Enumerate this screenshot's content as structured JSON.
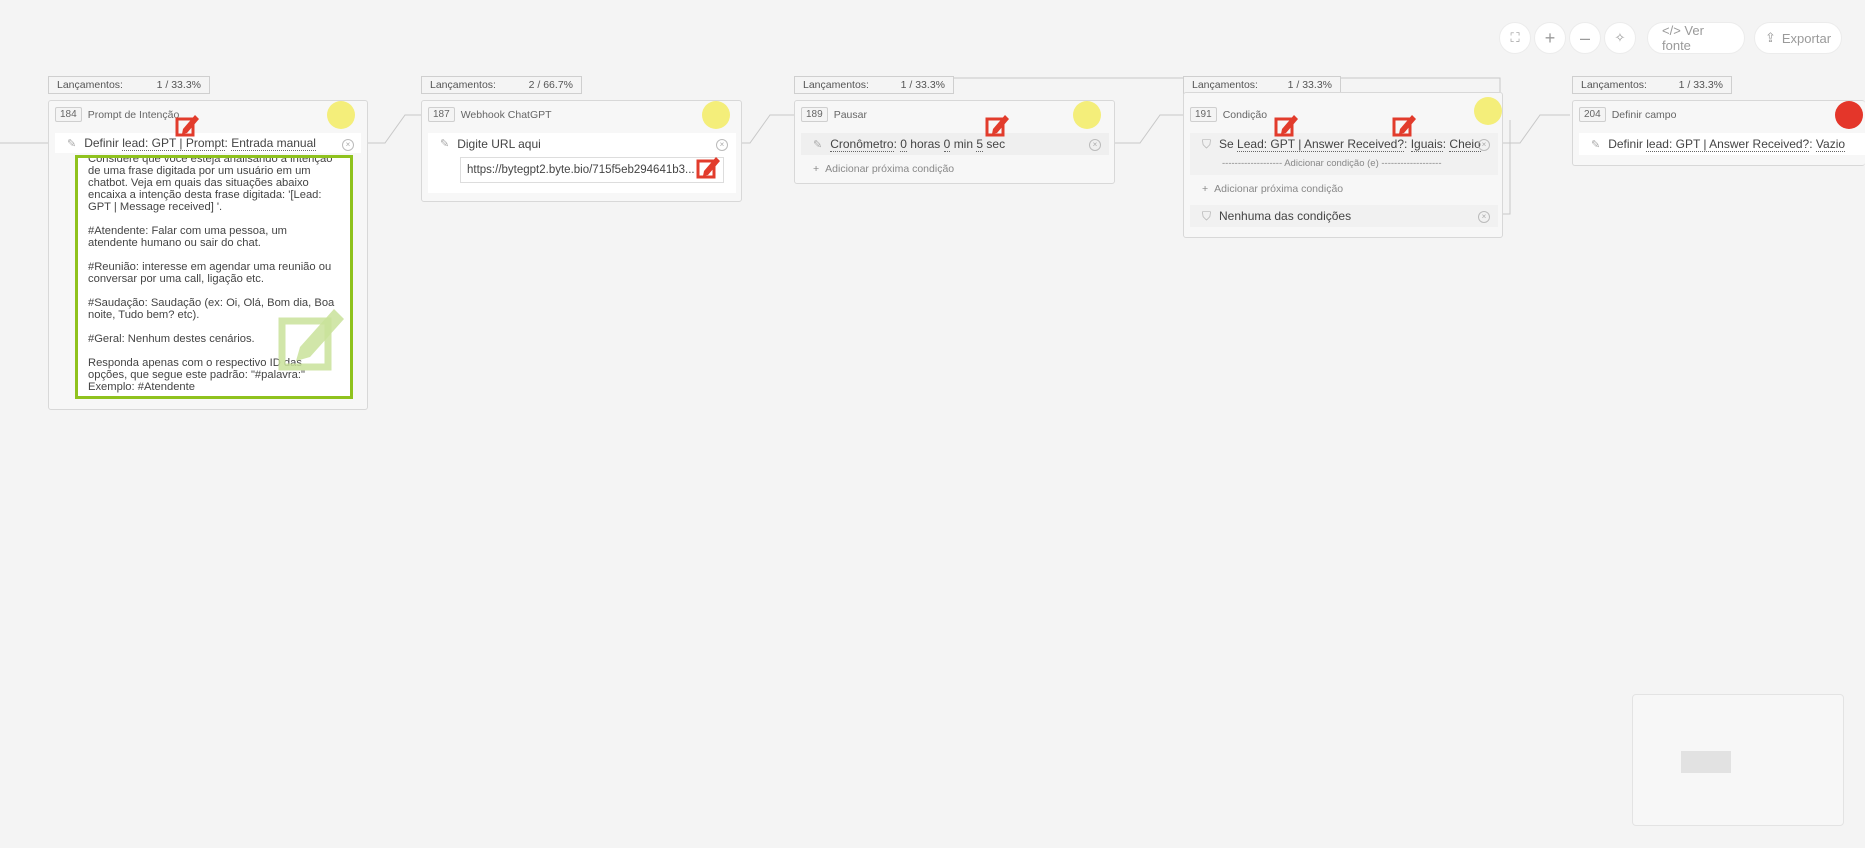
{
  "toolbar": {
    "source_label": "</> Ver fonte",
    "export_label": "Exportar"
  },
  "stats_label": "Lançamentos:",
  "nodes": [
    {
      "id": "184",
      "title": "Prompt de Intenção",
      "stats": "1 / 33.3%",
      "status_color": "#f4ee7a",
      "action": {
        "prefix": "Definir",
        "field": "lead: GPT | Prompt",
        "sep": ":",
        "value": "Entrada manual"
      },
      "prompt_lines": [
        "Considere que você esteja analisando a intenção",
        "de uma frase digitada por um usuário em um",
        "chatbot. Veja em quais das situações abaixo",
        "encaixa a intenção desta frase digitada: '[Lead:",
        "GPT | Message received] '.",
        "",
        "#Atendente: Falar com uma pessoa, um",
        "atendente humano ou sair do chat.",
        "",
        "#Reunião: interesse em agendar uma reunião ou",
        "conversar por uma call, ligação etc.",
        "",
        "#Saudação: Saudação (ex: Oi, Olá, Bom dia, Boa",
        "noite, Tudo bem? etc).",
        "",
        "#Geral: Nenhum destes cenários.",
        "",
        "Responda apenas com o respectivo ID das",
        "opções, que segue este padrão: \"#palavra:\"",
        "Exemplo: #Atendente"
      ]
    },
    {
      "id": "187",
      "title": "Webhook ChatGPT",
      "stats": "2 / 66.7%",
      "status_color": "#f4ee7a",
      "label": "Digite URL aqui",
      "url": "https://bytegpt2.byte.bio/715f5eb294641b3..."
    },
    {
      "id": "189",
      "title": "Pausar",
      "stats": "1 / 33.3%",
      "status_color": "#f4ee7a",
      "timer_label": "Cronômetro",
      "hours": "0",
      "hours_unit": "horas",
      "minutes": "0",
      "minutes_unit": "min",
      "seconds": "5",
      "seconds_unit": "sec",
      "add_label": "Adicionar próxima condição"
    },
    {
      "id": "191",
      "title": "Condição",
      "stats": "1 / 33.3%",
      "status_color": "#f4ee7a",
      "cond_prefix": "Se",
      "cond_field": "Lead: GPT | Answer Received?",
      "cond_op": "Iguais",
      "cond_value": "Cheio",
      "add_and_label": "------------------- Adicionar condição (e) -------------------",
      "add_next_label": "Adicionar próxima condição",
      "else_label": "Nenhuma das condições"
    },
    {
      "id": "204",
      "title": "Definir campo",
      "stats": "1 / 33.3%",
      "status_color": "#e4362a",
      "action": {
        "prefix": "Definir",
        "field": "lead: GPT | Answer Received?",
        "sep": ":",
        "value": "Vazio"
      }
    }
  ]
}
